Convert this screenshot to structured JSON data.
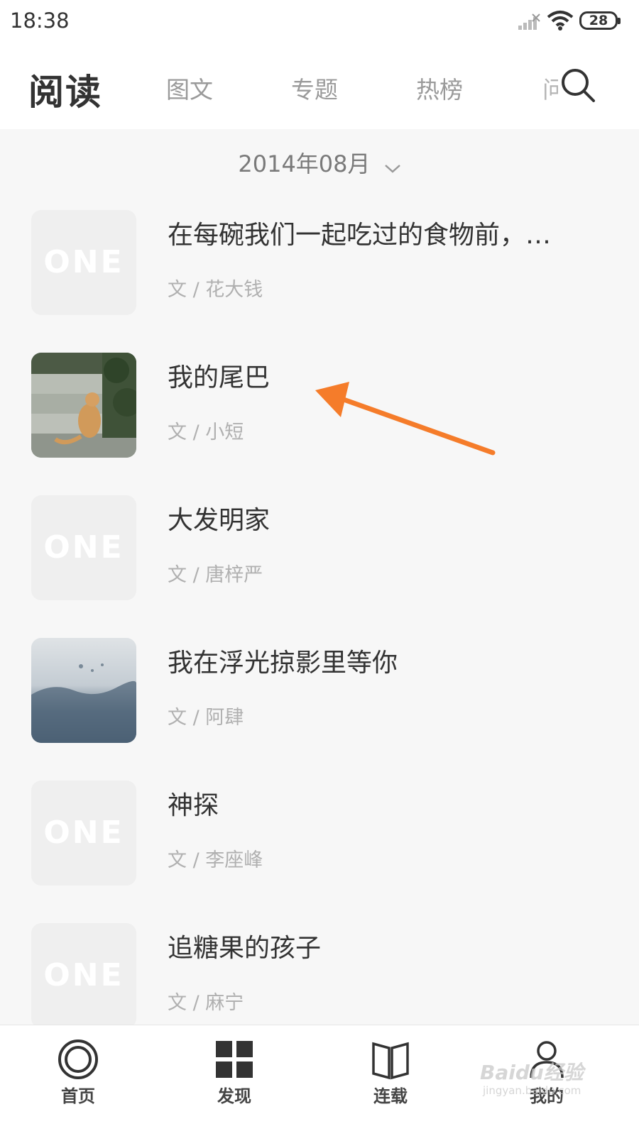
{
  "status_bar": {
    "time": "18:38",
    "battery": "28"
  },
  "header": {
    "title": "阅读",
    "tabs": [
      "图文",
      "专题",
      "热榜"
    ],
    "cut_tab": "问"
  },
  "month_selector": {
    "label": "2014年08月"
  },
  "articles": [
    {
      "title": "在每碗我们一起吃过的食物前，…",
      "author": "文 / 花大钱",
      "thumb": "ONE"
    },
    {
      "title": "我的尾巴",
      "author": "文 / 小短",
      "thumb": "cat-photo"
    },
    {
      "title": "大发明家",
      "author": "文 / 唐梓严",
      "thumb": "ONE"
    },
    {
      "title": "我在浮光掠影里等你",
      "author": "文 / 阿肆",
      "thumb": "water-photo"
    },
    {
      "title": "神探",
      "author": "文 / 李座峰",
      "thumb": "ONE"
    },
    {
      "title": "追糖果的孩子",
      "author": "文 / 麻宁",
      "thumb": "ONE"
    }
  ],
  "bottom_nav": [
    {
      "label": "首页",
      "icon": "home-circle-icon"
    },
    {
      "label": "发现",
      "icon": "grid-icon"
    },
    {
      "label": "连载",
      "icon": "book-icon"
    },
    {
      "label": "我的",
      "icon": "user-icon"
    }
  ],
  "watermark": {
    "text": "Baidu经验",
    "sub": "jingyan.baidu.com"
  },
  "colors": {
    "arrow": "#f57c2a",
    "tab_inactive": "#9a9a9a",
    "author": "#b0b0b0"
  }
}
